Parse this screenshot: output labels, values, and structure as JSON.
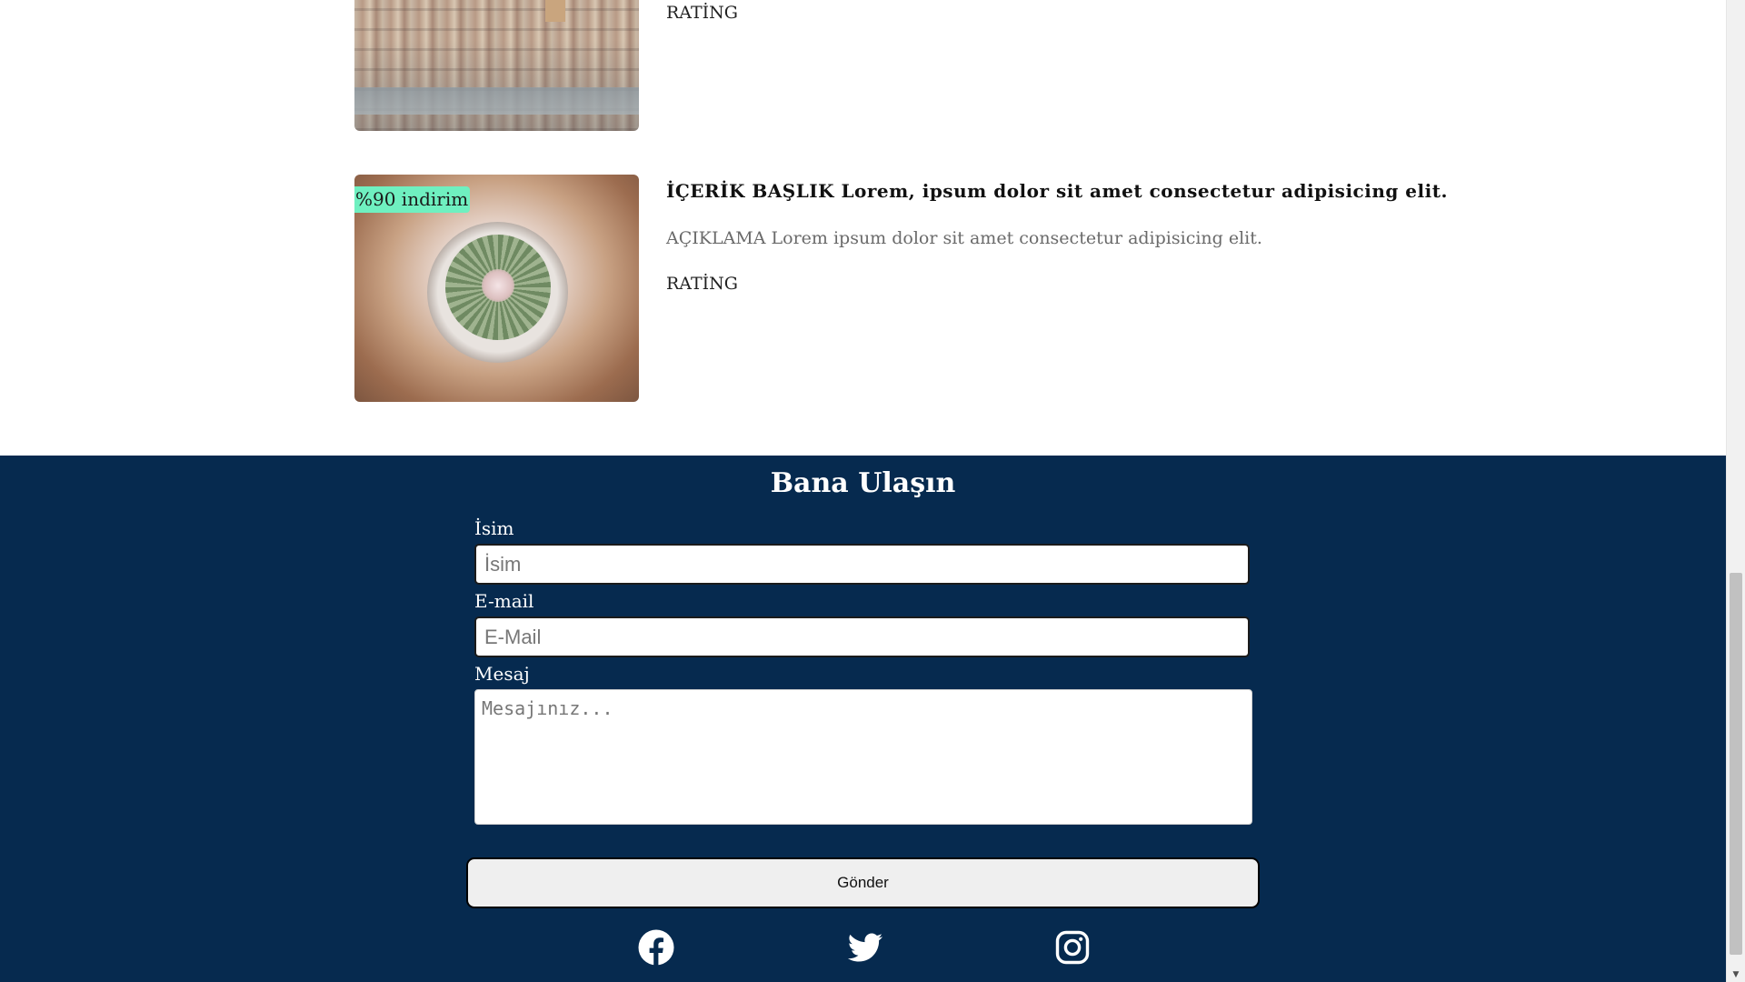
{
  "cards": [
    {
      "image": "city-photo",
      "rating": "RATİNG"
    },
    {
      "image": "cactus-photo",
      "badge": "%90 indirim",
      "title": "İÇERİK BAŞLIK Lorem, ipsum dolor sit amet consectetur adipisicing elit.",
      "description": "AÇIKLAMA Lorem ipsum dolor sit amet consectetur adipisicing elit.",
      "rating": "RATİNG"
    }
  ],
  "contact": {
    "title": "Bana Ulaşın",
    "name_label": "İsim",
    "name_placeholder": "İsim",
    "email_label": "E-mail",
    "email_placeholder": "E-Mail",
    "message_label": "Mesaj",
    "message_placeholder": "Mesajınız...",
    "submit_label": "Gönder",
    "background_color": "#062a4f",
    "badge_color": "#6ff0c0"
  },
  "socials": [
    {
      "icon": "facebook-icon"
    },
    {
      "icon": "twitter-icon"
    },
    {
      "icon": "instagram-icon"
    }
  ]
}
